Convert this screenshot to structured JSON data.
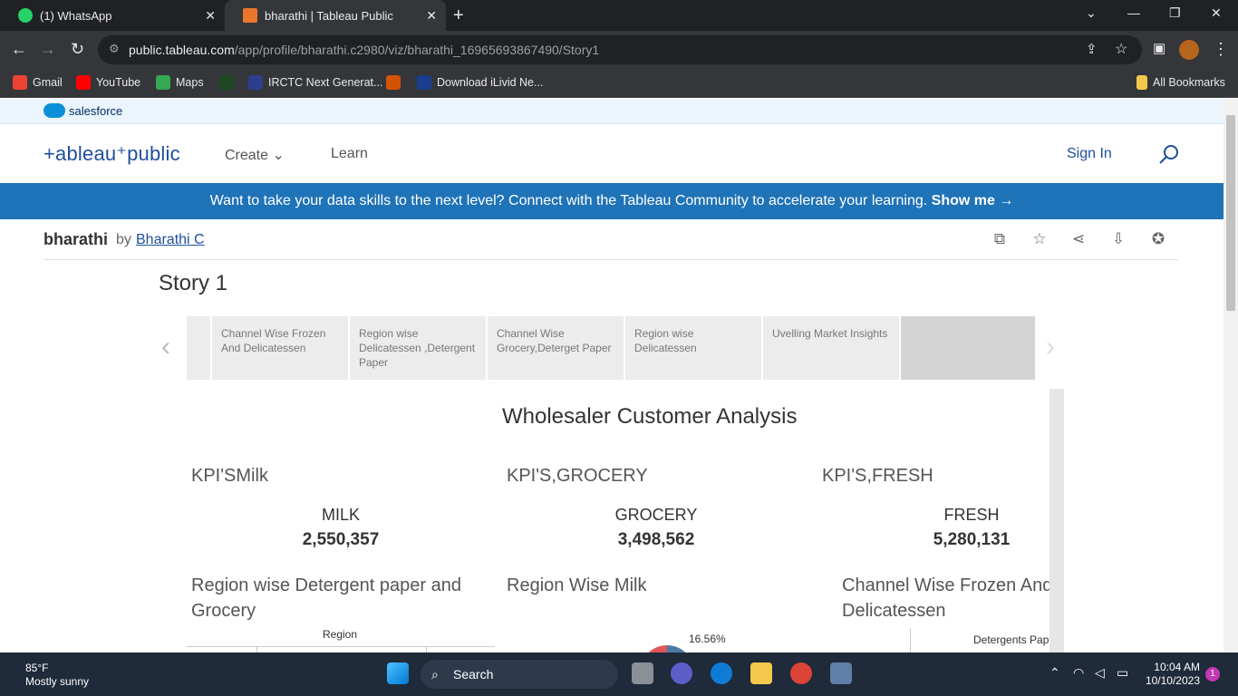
{
  "browser": {
    "tabs": [
      {
        "title": "(1) WhatsApp"
      },
      {
        "title": "bharathi | Tableau Public"
      }
    ],
    "url_host": "public.tableau.com",
    "url_path": "/app/profile/bharathi.c2980/viz/bharathi_16965693867490/Story1",
    "bookmarks": [
      "Gmail",
      "YouTube",
      "Maps",
      "IRCTC Next Generat...",
      "Download iLivid Ne..."
    ],
    "all_bookmarks": "All Bookmarks"
  },
  "site": {
    "salesforce": "salesforce",
    "logo": "+ableau⁺public",
    "nav": {
      "create": "Create",
      "learn": "Learn",
      "sign_in": "Sign In"
    },
    "banner_text": "Want to take your data skills to the next level? Connect with the Tableau Community to accelerate your learning.",
    "banner_link": "Show me →"
  },
  "viz": {
    "title": "bharathi",
    "by": "by",
    "author": "Bharathi C",
    "story_title": "Story 1",
    "story_points": [
      "Channel Wise Frozen And Delicatessen",
      "Region wise Delicatessen ,Detergent Paper",
      "Channel Wise Grocery,Deterget Paper",
      "Region wise Delicatessen",
      "Uvelling Market Insights",
      ""
    ]
  },
  "dashboard": {
    "title": "Wholesaler Customer Analysis",
    "kpis": [
      {
        "label": "KPI'SMilk",
        "name": "MILK",
        "value": "2,550,357"
      },
      {
        "label": "KPI'S,GROCERY",
        "name": "GROCERY",
        "value": "3,498,562"
      },
      {
        "label": "KPI'S,FRESH",
        "name": "FRESH",
        "value": "5,280,131"
      }
    ],
    "sheets": [
      {
        "title": "Region wise Detergent paper and Grocery",
        "sub": "Region"
      },
      {
        "title": "Region Wise Milk",
        "sub": "16.56%"
      },
      {
        "title": "Channel Wise Frozen And Delicatessen",
        "sub": "Detergents Pap"
      }
    ]
  },
  "taskbar": {
    "temp": "85°F",
    "weather": "Mostly sunny",
    "search": "Search",
    "time": "10:04 AM",
    "date": "10/10/2023",
    "notifications": "1"
  }
}
